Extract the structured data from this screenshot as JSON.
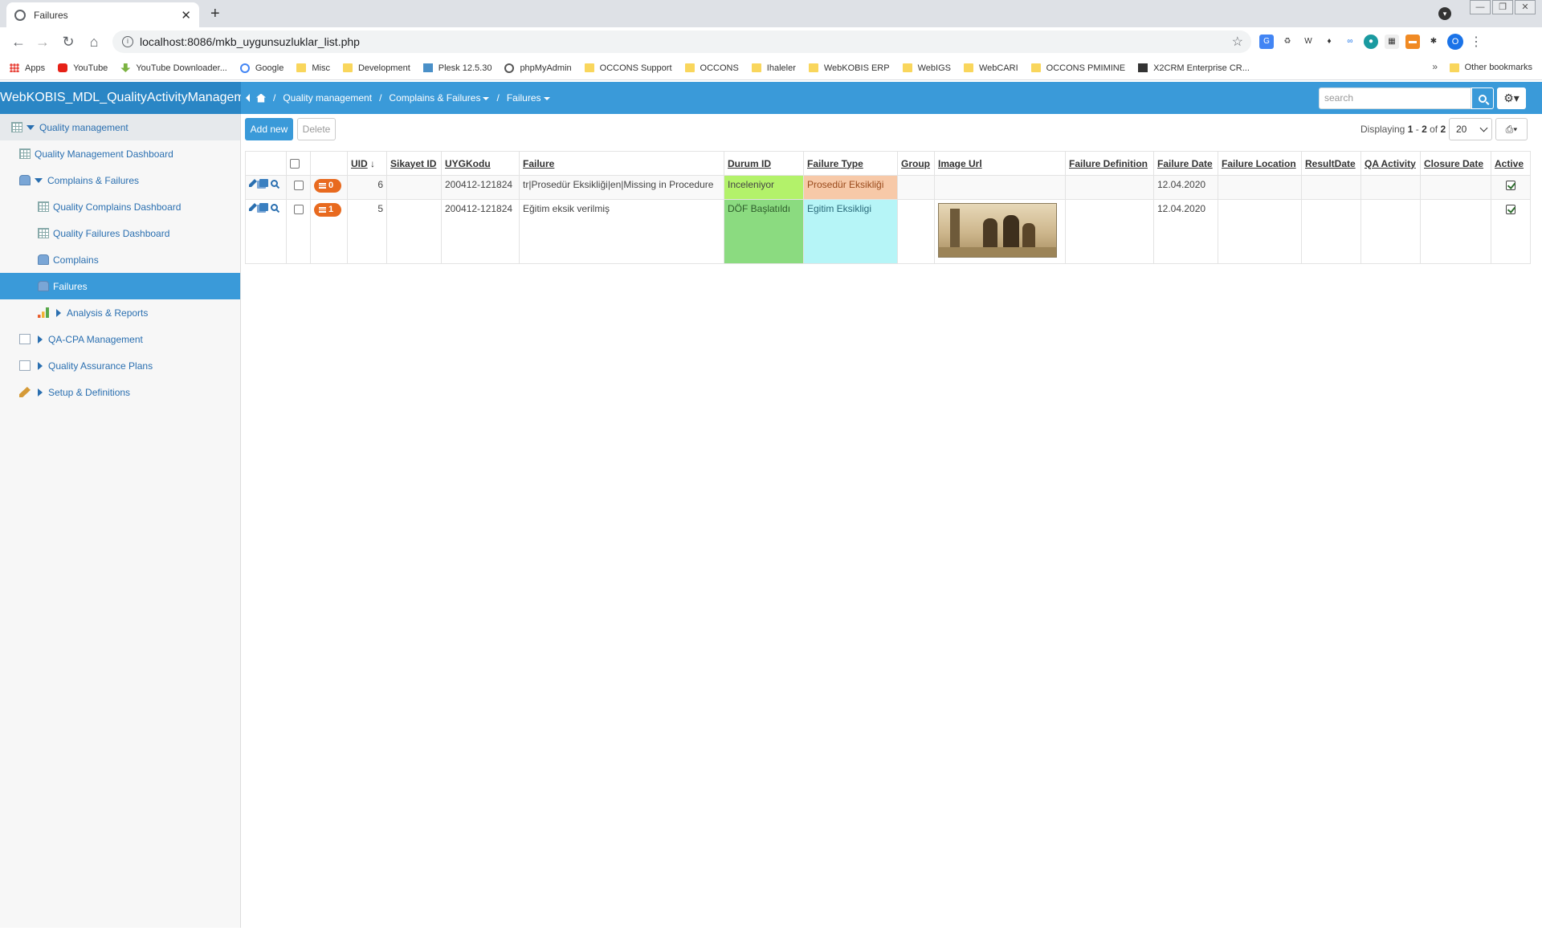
{
  "browser": {
    "tab_title": "Failures",
    "url": "localhost:8086/mkb_uygunsuzluklar_list.php",
    "bookmarks": [
      "Apps",
      "YouTube",
      "YouTube Downloader...",
      "Google",
      "Misc",
      "Development",
      "Plesk 12.5.30",
      "phpMyAdmin",
      "OCCONS Support",
      "OCCONS",
      "Ihaleler",
      "WebKOBIS ERP",
      "WebIGS",
      "WebCARI",
      "OCCONS PMIMINE",
      "X2CRM Enterprise CR..."
    ],
    "bookmarks_more": "»",
    "other_bookmarks": "Other bookmarks",
    "profile_initial": "O"
  },
  "app": {
    "brand": "WebKOBIS_MDL_QualityActivityManagement",
    "breadcrumbs": [
      "Quality management",
      "Complains & Failures",
      "Failures"
    ],
    "search_placeholder": "search"
  },
  "sidebar": {
    "items": [
      {
        "label": "Quality management",
        "icon": "module-icon"
      },
      {
        "label": "Quality Management Dashboard",
        "icon": "dashboard-icon"
      },
      {
        "label": "Complains & Failures",
        "icon": "people-icon"
      },
      {
        "label": "Quality Complains Dashboard",
        "icon": "dashboard-icon"
      },
      {
        "label": "Quality Failures Dashboard",
        "icon": "dashboard-icon"
      },
      {
        "label": "Complains",
        "icon": "people-icon"
      },
      {
        "label": "Failures",
        "icon": "people-icon"
      },
      {
        "label": "Analysis & Reports",
        "icon": "bar-chart-icon"
      },
      {
        "label": "QA-CPA Management",
        "icon": "page-icon"
      },
      {
        "label": "Quality Assurance Plans",
        "icon": "page-icon"
      },
      {
        "label": "Setup & Definitions",
        "icon": "wrench-icon"
      }
    ]
  },
  "list": {
    "add_label": "Add new",
    "delete_label": "Delete",
    "displaying_prefix": "Displaying",
    "range_from": "1",
    "range_to": "2",
    "of_word": "of",
    "total": "2",
    "page_size": "20",
    "columns": [
      "UID",
      "Sikayet ID",
      "UYGKodu",
      "Failure",
      "Durum ID",
      "Failure Type",
      "Group",
      "Image Url",
      "Failure Definition",
      "Failure Date",
      "Failure Location",
      "ResultDate",
      "QA Activity",
      "Closure Date",
      "Active"
    ],
    "sort_indicator": "↓",
    "rows": [
      {
        "badge": "0",
        "uid": "6",
        "sikayet_id": "",
        "uygkodu": "200412-121824",
        "failure": "tr|Prosedür Eksikliği|en|Missing in Procedure",
        "durum": "Inceleniyor",
        "failure_type": "Prosedür Eksikliği",
        "group": "",
        "failure_definition": "",
        "failure_date": "12.04.2020",
        "failure_location": "",
        "result_date": "",
        "qa_activity": "",
        "closure_date": ""
      },
      {
        "badge": "1",
        "uid": "5",
        "sikayet_id": "",
        "uygkodu": "200412-121824",
        "failure": "Eğitim eksik verilmiş",
        "durum": "DÖF Başlatıldı",
        "failure_type": "Egitim Eksikligi",
        "group": "",
        "failure_definition": "",
        "failure_date": "12.04.2020",
        "failure_location": "",
        "result_date": "",
        "qa_activity": "",
        "closure_date": ""
      }
    ]
  },
  "colors": {
    "header_blue": "#3a9ad9",
    "status_inceleniyor": "#b3f26a",
    "type_prosedur": "#f7c9a8",
    "status_dof": "#8bdb80",
    "type_egitim": "#b6f5f7",
    "badge_orange": "#e86a1f"
  }
}
